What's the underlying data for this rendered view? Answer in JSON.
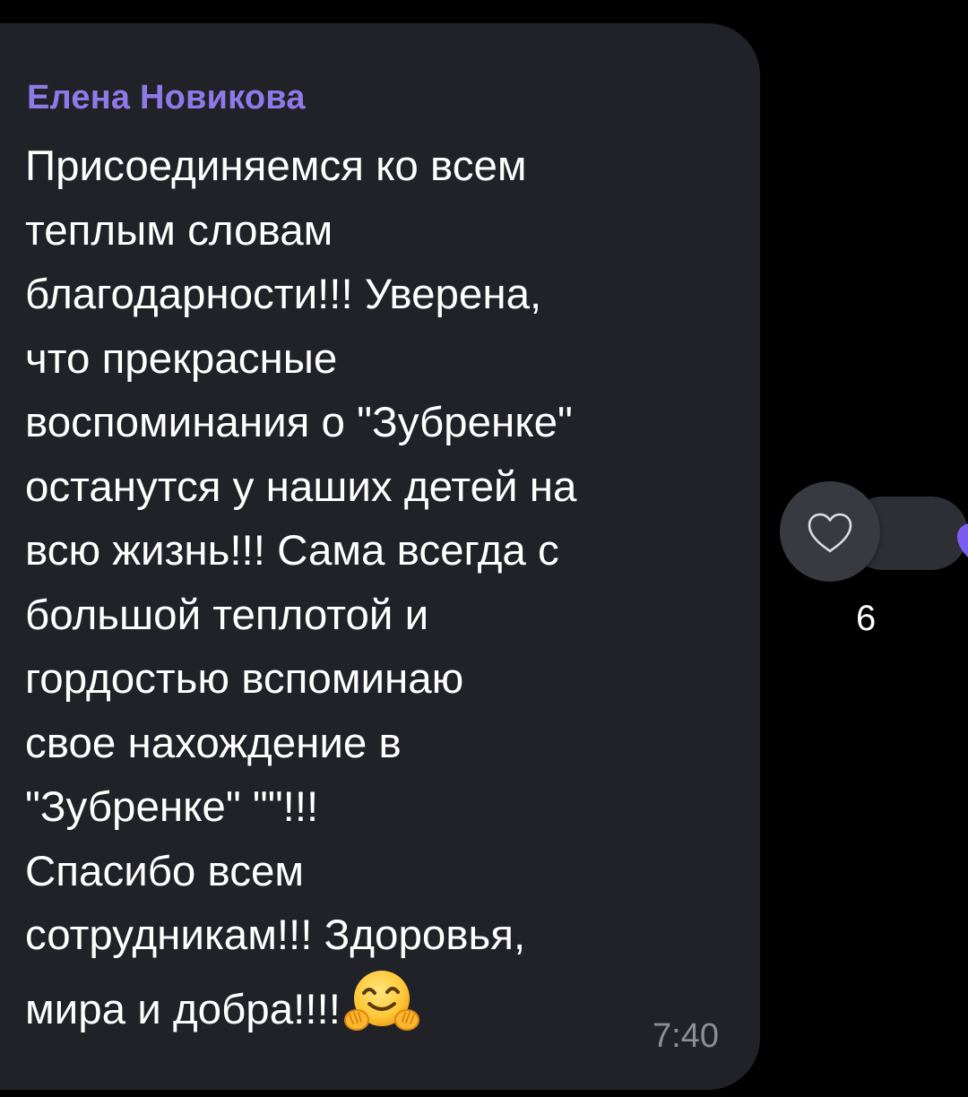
{
  "message": {
    "sender": "Елена Новикова",
    "lines": [
      "Присоединяемся ко всем",
      "теплым словам",
      "благодарности!!! Уверена,",
      "что прекрасные",
      "воспоминания о \"Зубренке\"",
      "останутся у наших детей на",
      "всю жизнь!!! Сама всегда с",
      "большой теплотой и",
      "гордостью вспоминаю",
      "свое нахождение в",
      "\"Зубренке\" \"\"!!!",
      "Спасибо всем",
      "сотрудникам!!! Здоровья,",
      "мира и добра!!!!"
    ],
    "trailing_emoji": "hugging-face-emoji",
    "time": "7:40"
  },
  "reactions": {
    "add_icon": "heart-outline-icon",
    "items": [
      {
        "icon": "purple-heart-icon",
        "color": "#7b5cf0",
        "count": "6"
      }
    ]
  },
  "colors": {
    "background": "#000000",
    "bubble": "#212227",
    "sender_name": "#8f79e8",
    "message_text": "#ffffff",
    "timestamp": "#8d8e93",
    "reaction_pill": "#2e2f35",
    "reaction_button": "#393a40"
  }
}
